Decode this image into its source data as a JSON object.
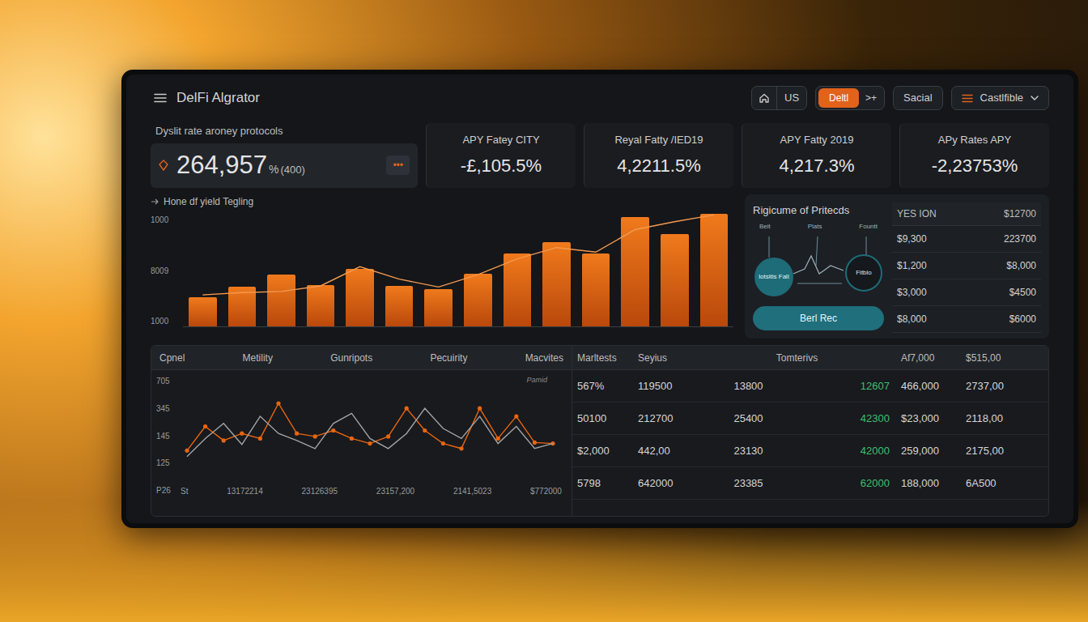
{
  "header": {
    "title": "DelFi Algrator",
    "region": "US",
    "pill": {
      "label": "Deltl",
      "selected": true
    },
    "pill_action": ">+",
    "social": "Sacial",
    "dropdown": "Castlfible"
  },
  "summary": {
    "label": "Dyslit rate aroney protocols",
    "value": "264,957",
    "unit": "%",
    "note": "(400)",
    "more": "•••"
  },
  "stats": [
    {
      "label": "APY Fatey CITY",
      "value": "-£,105.5%"
    },
    {
      "label": "Reyal Fatty /IED19",
      "value": "4,2211.5%"
    },
    {
      "label": "APY Fatty 2019",
      "value": "4,217.3%"
    },
    {
      "label": "APy Rates APY",
      "value": "-2,23753%"
    }
  ],
  "yield_chart": {
    "title": "Hone df yield Tegling",
    "y_ticks": [
      "1000",
      "8009",
      "1000"
    ],
    "bars": [
      26,
      35,
      46,
      37,
      51,
      36,
      33,
      47,
      65,
      75,
      65,
      97,
      82,
      100
    ],
    "line": [
      28,
      30,
      31,
      36,
      53,
      42,
      35,
      46,
      60,
      70,
      66,
      86,
      93,
      99
    ]
  },
  "protocols": {
    "title": "Rigicume of Pritecds",
    "labels": [
      "Beit",
      "Plats",
      "Fountt"
    ],
    "nodes": [
      {
        "label": "lotsitis Fall",
        "kind": "filled"
      },
      {
        "label": "Fitblo",
        "kind": "outlined"
      }
    ],
    "button": "Berl Rec",
    "header": [
      "YES ION",
      "$12700"
    ],
    "rows": [
      [
        "$9,300",
        "223700"
      ],
      [
        "$1,200",
        "$8,000"
      ],
      [
        "$3,000",
        "$4500"
      ],
      [
        "$8,000",
        "$6000"
      ]
    ]
  },
  "markets": {
    "columns": [
      "Cpnel",
      "Metility",
      "Gunripots",
      "Pecuirity",
      "Macvites",
      "Marltests",
      "Seyius",
      "Tomterivs",
      "Af7,000",
      "$515,00"
    ],
    "chart": {
      "label": "Pamid",
      "y_ticks": [
        "705",
        "345",
        "145",
        "125",
        "P26"
      ],
      "x_ticks": [
        "St",
        "13172214",
        "23126395",
        "23157,200",
        "2141,5023",
        "$772000"
      ],
      "series": [
        {
          "values": [
            28,
            52,
            38,
            45,
            40,
            75,
            45,
            42,
            48,
            40,
            35,
            42,
            70,
            48,
            35,
            30,
            70,
            40,
            62,
            36,
            35
          ],
          "color": "#e8650f"
        },
        {
          "values": [
            22,
            40,
            55,
            34,
            62,
            45,
            38,
            30,
            55,
            65,
            40,
            30,
            45,
            70,
            50,
            40,
            62,
            35,
            52,
            30,
            35
          ],
          "color": "#a3a3a3"
        }
      ]
    },
    "rows": [
      [
        "567%",
        "119500",
        "13800",
        "12607",
        "466,000",
        "2737,00"
      ],
      [
        "50100",
        "212700",
        "25400",
        "42300",
        "$23,000",
        "2118,00"
      ],
      [
        "$2,000",
        "442,00",
        "23130",
        "42000",
        "259,000",
        "2175,00"
      ],
      [
        "5798",
        "642000",
        "23385",
        "62000",
        "188,000",
        "6A500"
      ]
    ]
  }
}
